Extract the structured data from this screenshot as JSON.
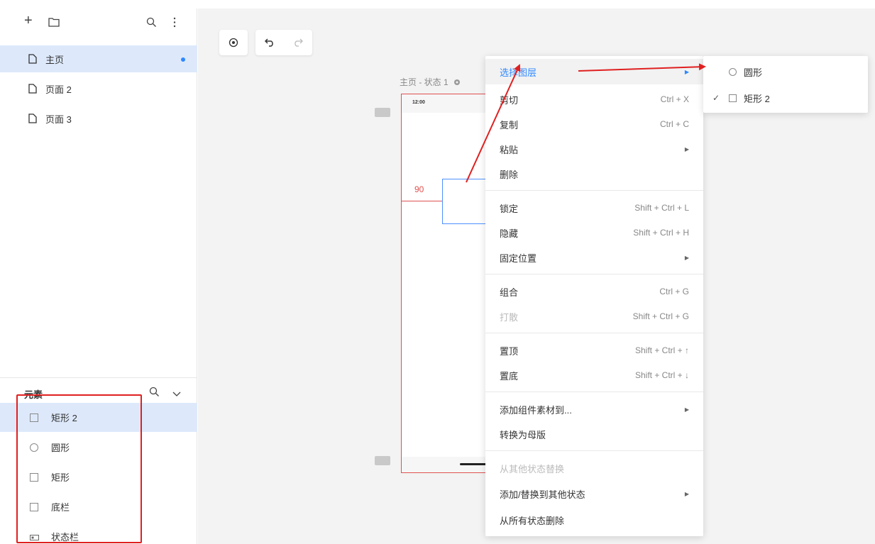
{
  "pages": [
    {
      "label": "主页",
      "active": true
    },
    {
      "label": "页面 2",
      "active": false
    },
    {
      "label": "页面 3",
      "active": false
    }
  ],
  "elements_panel": {
    "title": "元素",
    "items": [
      {
        "label": "矩形 2",
        "icon": "rect-icon",
        "active": true
      },
      {
        "label": "圆形",
        "icon": "circle-icon",
        "active": false
      },
      {
        "label": "矩形",
        "icon": "rect-icon",
        "active": false
      },
      {
        "label": "底栏",
        "icon": "rect-icon",
        "active": false
      },
      {
        "label": "状态栏",
        "icon": "statusbar-icon",
        "active": false
      }
    ]
  },
  "collapse_label": "«",
  "canvas": {
    "state_label": "主页 - 状态 1",
    "status_time": "12:00",
    "measure_value": "90"
  },
  "context_menu": {
    "items": [
      {
        "label": "选择图层",
        "shortcut": "",
        "submenu": true,
        "highlighted": true
      },
      {
        "label": "剪切",
        "shortcut": "Ctrl + X"
      },
      {
        "label": "复制",
        "shortcut": "Ctrl + C"
      },
      {
        "label": "粘贴",
        "shortcut": "",
        "submenu": true
      },
      {
        "label": "删除",
        "shortcut": ""
      },
      {
        "label": "锁定",
        "shortcut": "Shift + Ctrl + L"
      },
      {
        "label": "隐藏",
        "shortcut": "Shift + Ctrl + H"
      },
      {
        "label": "固定位置",
        "shortcut": "",
        "submenu": true
      },
      {
        "label": "组合",
        "shortcut": "Ctrl + G"
      },
      {
        "label": "打散",
        "shortcut": "Shift + Ctrl + G",
        "disabled": true
      },
      {
        "label": "置顶",
        "shortcut": "Shift + Ctrl + ↑"
      },
      {
        "label": "置底",
        "shortcut": "Shift + Ctrl + ↓"
      },
      {
        "label": "添加组件素材到...",
        "shortcut": "",
        "submenu": true
      },
      {
        "label": "转换为母版",
        "shortcut": ""
      },
      {
        "label": "从其他状态替换",
        "shortcut": "",
        "disabled": true
      },
      {
        "label": "添加/替换到其他状态",
        "shortcut": "",
        "submenu": true
      },
      {
        "label": "从所有状态删除",
        "shortcut": ""
      }
    ]
  },
  "layer_submenu": {
    "items": [
      {
        "label": "圆形",
        "checked": false,
        "icon": "circle-icon"
      },
      {
        "label": "矩形 2",
        "checked": true,
        "icon": "rect-icon"
      }
    ]
  },
  "colors": {
    "accent": "#2f88ff",
    "annotation_red": "#e02020",
    "selection_bg": "#dde9fb"
  }
}
